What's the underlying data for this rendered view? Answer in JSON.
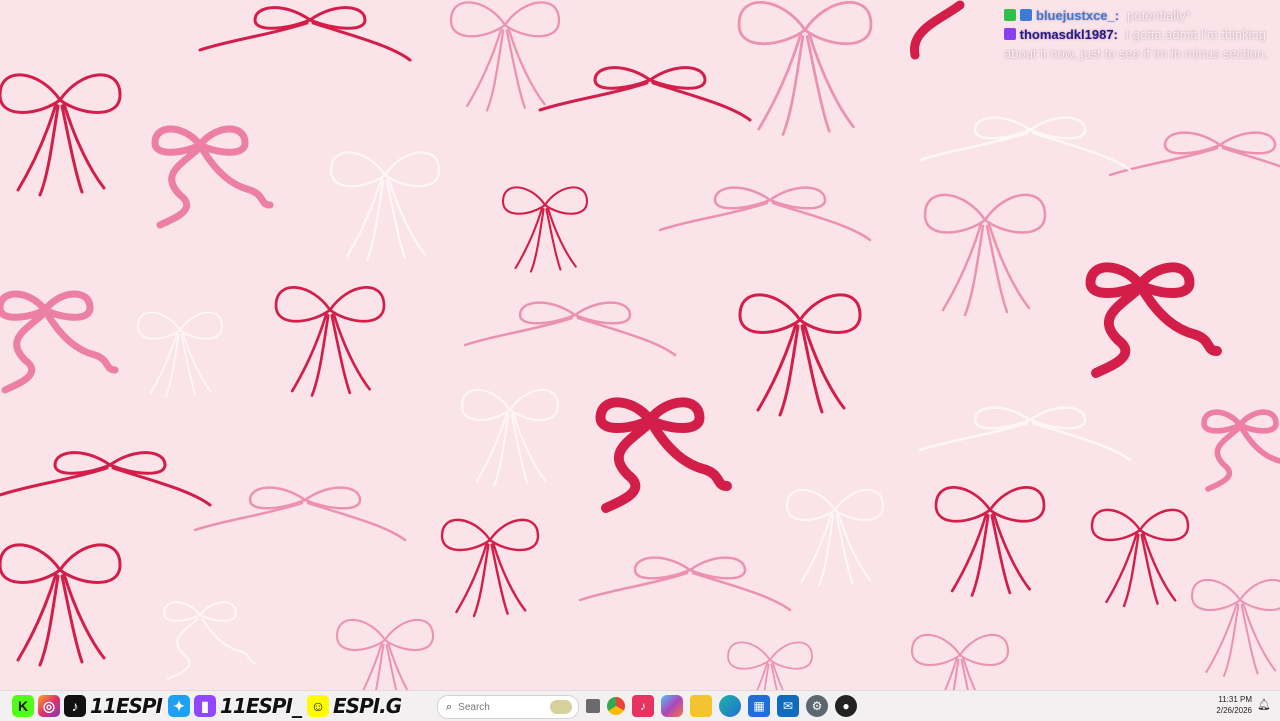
{
  "chat": {
    "messages": [
      {
        "user": "bluejustxce_:",
        "text": "potentially*",
        "user_color": "#3a7bd5",
        "badges": [
          "green",
          "blue"
        ]
      },
      {
        "user": "thomasdkl1987:",
        "text": "I gotta admit I'm thinking about it now, just to see if im in minus section.",
        "user_color": "#1f1a8a",
        "badges": [
          "purple"
        ]
      }
    ]
  },
  "socials": {
    "handle_1": "11ESPI",
    "handle_2": "11ESPI_",
    "handle_3": "ESPI.G",
    "icons": [
      "kick-icon",
      "instagram-icon",
      "tiktok-icon",
      "twitter-icon",
      "twitch-icon",
      "snapchat-icon"
    ]
  },
  "taskbar": {
    "search_placeholder": "Search",
    "time": "11:31 PM",
    "date": "2/26/2026",
    "apps": [
      "task-view-icon",
      "chrome-icon",
      "capcut-icon",
      "copilot-icon",
      "file-explorer-icon",
      "edge-icon",
      "store-icon",
      "outlook-icon",
      "settings-icon",
      "obs-icon"
    ]
  },
  "colors": {
    "wallpaper_bg": "#fbe3ea",
    "bow_red": "#d41e4a",
    "bow_pink": "#ec7fa3",
    "bow_light": "#f2b6c8",
    "bow_white": "#fff6f8"
  }
}
